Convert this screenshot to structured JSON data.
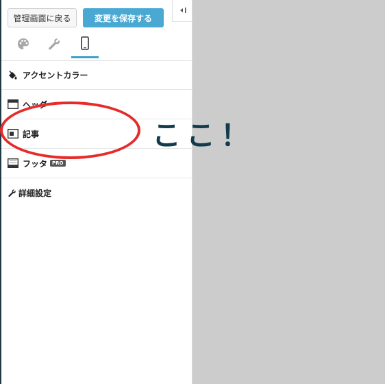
{
  "toolbar": {
    "back_label": "管理画面に戻る",
    "save_label": "変更を保存する",
    "collapse_icon": "collapse-left-icon",
    "accent_color": "#4aa9d3"
  },
  "tabs": [
    {
      "icon": "palette-icon",
      "active": false
    },
    {
      "icon": "wrench-icon",
      "active": false
    },
    {
      "icon": "mobile-icon",
      "active": true
    }
  ],
  "menu": {
    "items": [
      {
        "label": "アクセントカラー",
        "icon": "paint-bucket-icon"
      },
      {
        "label": "ヘッダ",
        "icon": "header-layout-icon"
      },
      {
        "label": "記事",
        "icon": "article-layout-icon"
      },
      {
        "label": "フッタ",
        "icon": "footer-layout-icon",
        "badge": "PRO"
      }
    ],
    "advanced_label": "詳細設定"
  },
  "annotation": {
    "text": "ここ！",
    "highlight_color": "#e52b2b",
    "text_color": "#123b4d"
  }
}
